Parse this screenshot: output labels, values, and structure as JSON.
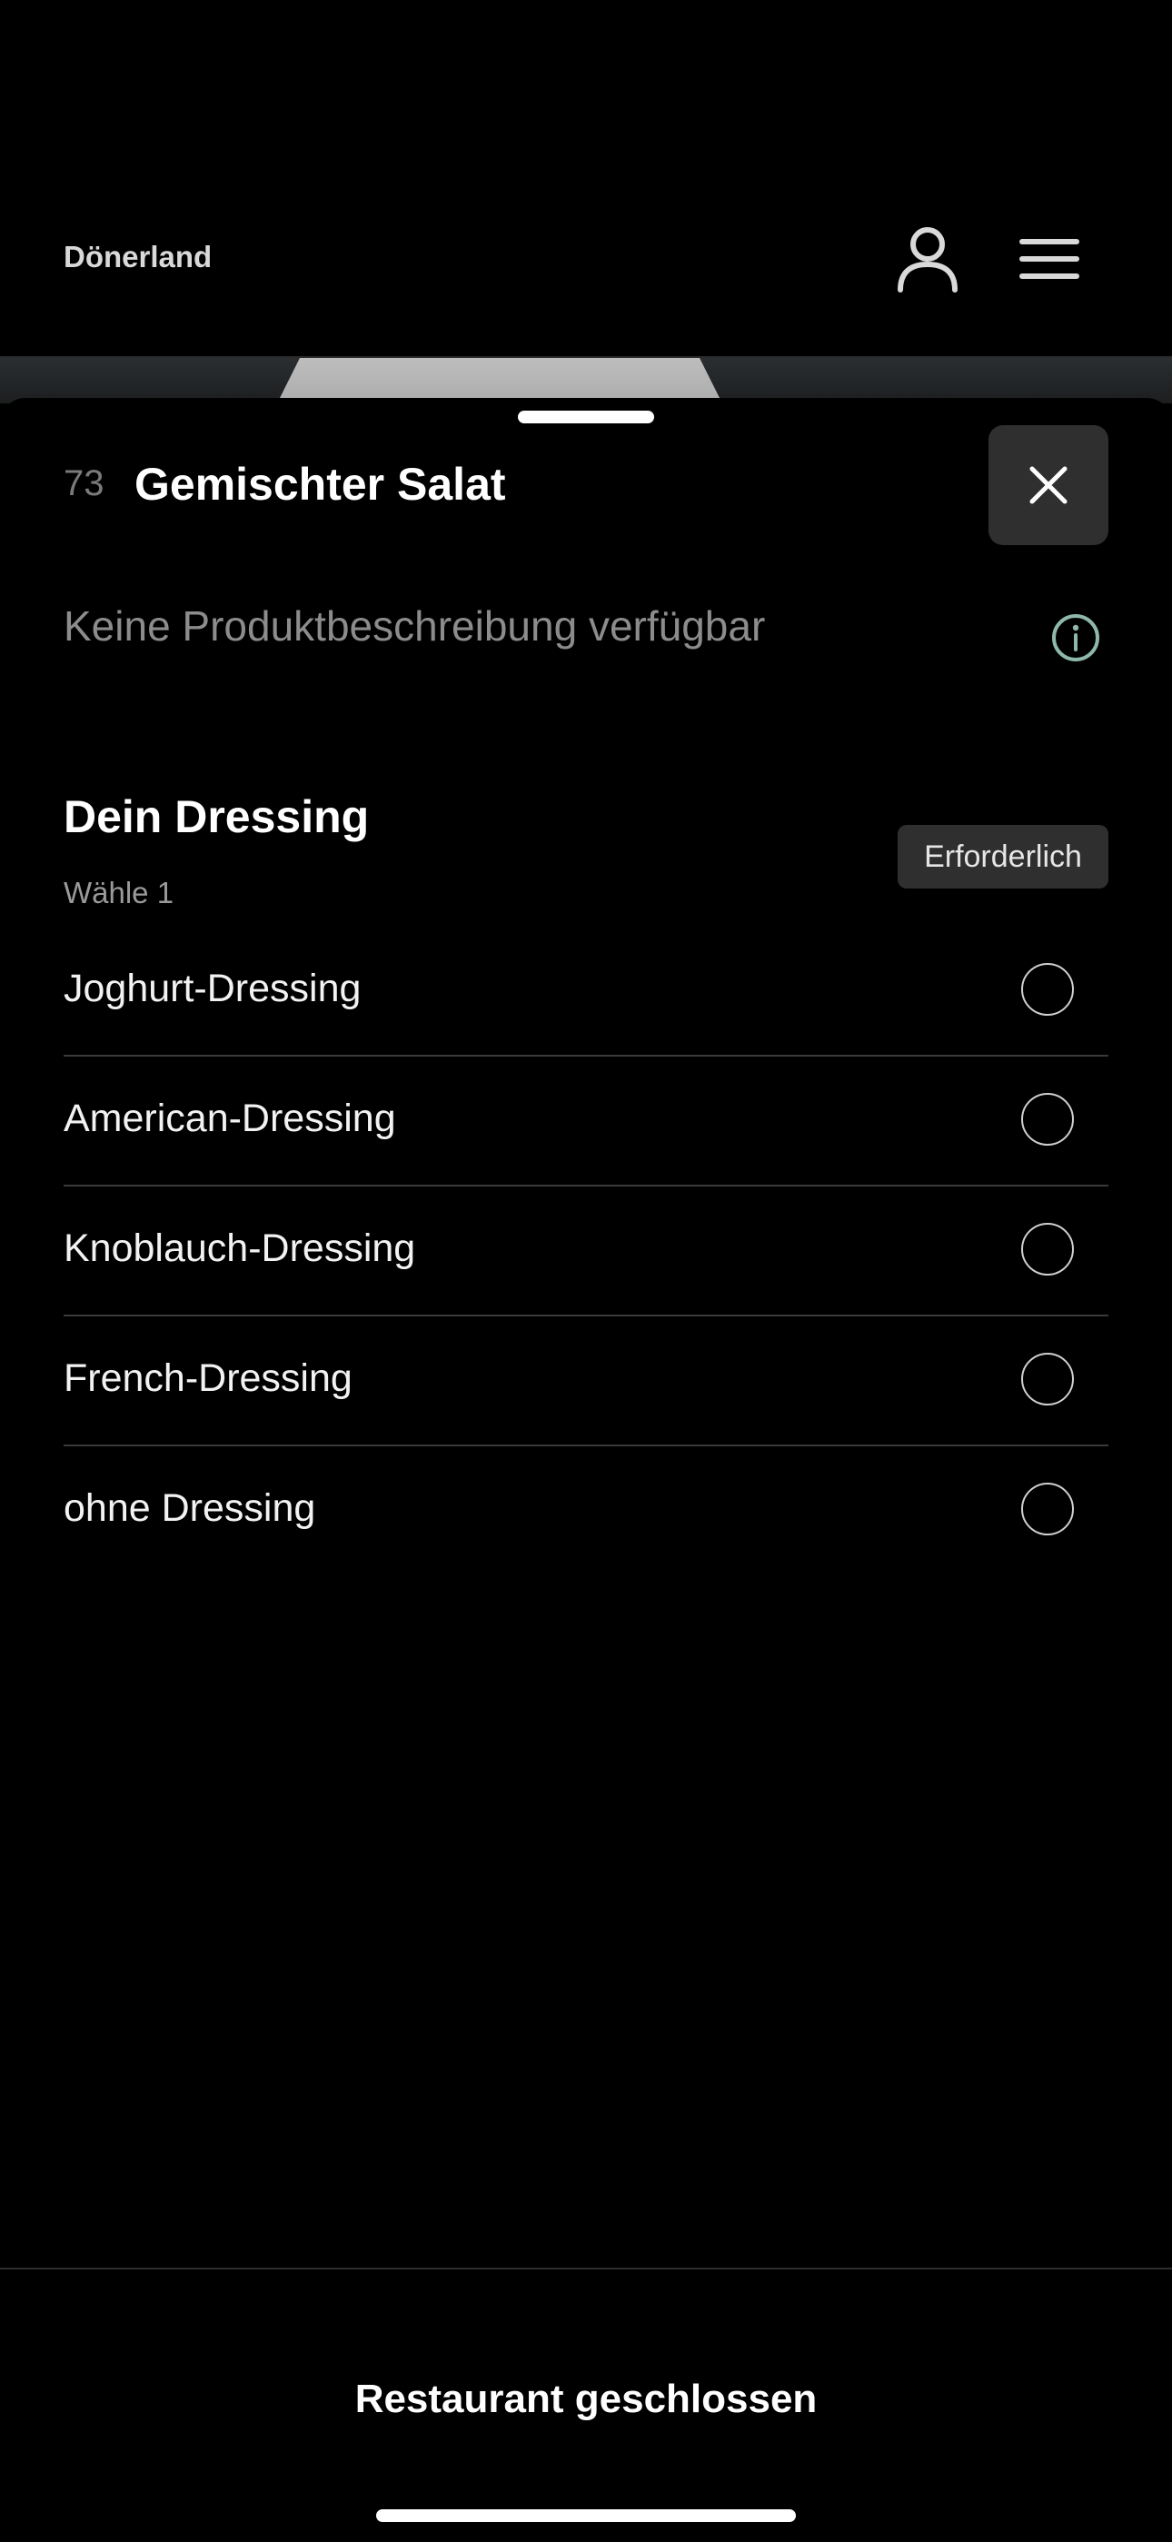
{
  "header": {
    "brand": "Dönerland",
    "account_icon": "user-icon",
    "menu_icon": "hamburger-menu-icon"
  },
  "product": {
    "number": "73",
    "title": "Gemischter Salat",
    "description": "Keine Produktbeschreibung verfügbar",
    "close_icon": "close-icon",
    "info_icon": "info-icon"
  },
  "option_group": {
    "title": "Dein Dressing",
    "subtitle": "Wähle 1",
    "badge": "Erforderlich",
    "options": [
      {
        "label": "Joghurt-Dressing",
        "selected": false
      },
      {
        "label": "American-Dressing",
        "selected": false
      },
      {
        "label": "Knoblauch-Dressing",
        "selected": false
      },
      {
        "label": "French-Dressing",
        "selected": false
      },
      {
        "label": "ohne Dressing",
        "selected": false
      }
    ]
  },
  "footer": {
    "status_label": "Restaurant geschlossen"
  },
  "colors": {
    "background": "#000000",
    "surface": "#2f2f2f",
    "muted_text": "#8c8c8c",
    "info_accent": "#8fb8a8"
  }
}
